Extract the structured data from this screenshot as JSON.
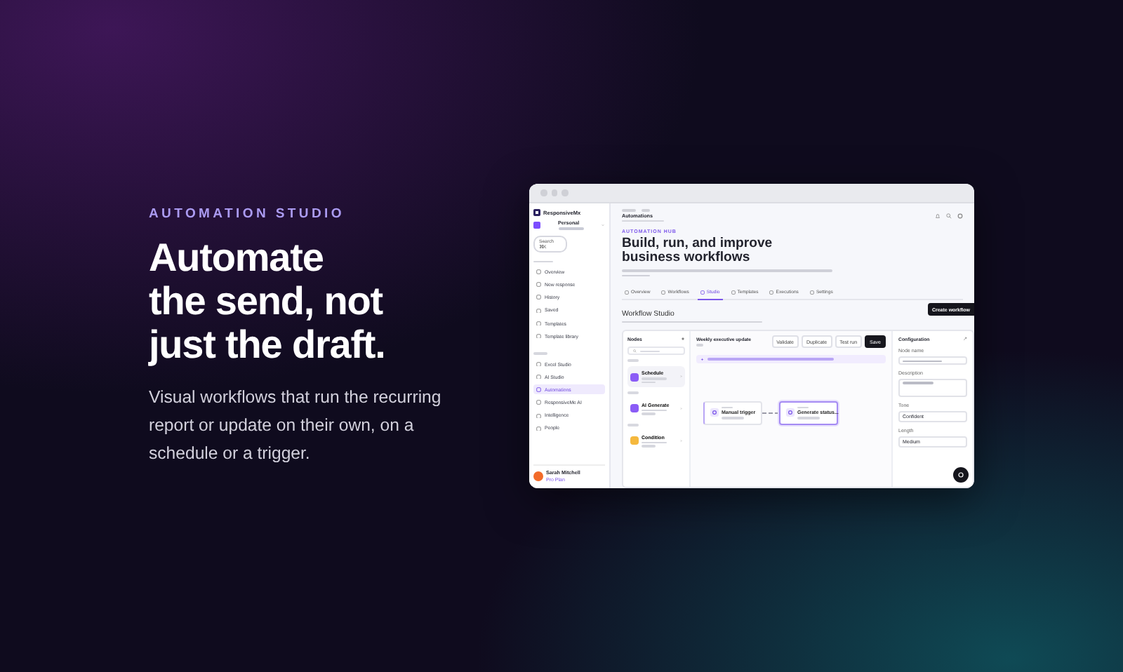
{
  "hero": {
    "eyebrow": "AUTOMATION STUDIO",
    "headline_lines": [
      "Automate",
      "the send, not",
      "just the draft."
    ],
    "body": "Visual workflows that run the recurring report or update on their own, on a schedule or a trigger."
  },
  "app": {
    "sidebar": {
      "brand": "ResponsiveMx",
      "workspace": "Personal",
      "search": "Search ⌘K",
      "main_items": [
        {
          "label": "Overview",
          "selected": false
        },
        {
          "label": "New response",
          "selected": false
        },
        {
          "label": "History",
          "selected": false
        },
        {
          "label": "Saved",
          "selected": false
        },
        {
          "label": "Templates",
          "selected": false
        },
        {
          "label": "Template library",
          "selected": false
        }
      ],
      "studio_items": [
        {
          "label": "Excel Studio",
          "selected": false
        },
        {
          "label": "AI Studio",
          "selected": false
        },
        {
          "label": "Automations",
          "selected": true
        },
        {
          "label": "ResponsiveMe AI",
          "selected": false
        },
        {
          "label": "Intelligence",
          "selected": false
        },
        {
          "label": "People",
          "selected": false
        }
      ],
      "user": {
        "name": "Sarah Mitchell",
        "plan": "Pro Plan"
      }
    },
    "header": {
      "title": "Automations"
    },
    "eyebrow": "AUTOMATION HUB",
    "title": "Build, run, and improve business workflows",
    "create_button": "Create workflow",
    "tabs": [
      {
        "label": "Overview",
        "selected": false
      },
      {
        "label": "Workflows",
        "selected": false
      },
      {
        "label": "Studio",
        "selected": true
      },
      {
        "label": "Templates",
        "selected": false
      },
      {
        "label": "Executions",
        "selected": false
      },
      {
        "label": "Settings",
        "selected": false
      }
    ],
    "studio": {
      "title": "Workflow Studio",
      "nodes_panel": {
        "title": "Nodes",
        "nodes": [
          {
            "label": "Schedule",
            "color": "#8b5cf6",
            "selected": true
          },
          {
            "label": "AI Generate",
            "color": "#8b5cf6",
            "selected": false
          },
          {
            "label": "Condition",
            "color": "#f5b83d",
            "selected": false
          }
        ]
      },
      "canvas": {
        "workflow_name": "Weekly executive update",
        "actions": [
          {
            "label": "Validate",
            "kind": "outline"
          },
          {
            "label": "Duplicate",
            "kind": "outline"
          },
          {
            "label": "Test run",
            "kind": "outline"
          },
          {
            "label": "Save",
            "kind": "primary"
          }
        ],
        "nodes": [
          {
            "label": "Manual trigger",
            "selected": false
          },
          {
            "label": "Generate status...",
            "selected": true
          }
        ]
      },
      "config": {
        "title": "Configuration",
        "fields": [
          {
            "label": "Node name"
          },
          {
            "label": "Description"
          },
          {
            "label": "Tone",
            "value": "Confident"
          },
          {
            "label": "Length",
            "value": "Medium"
          }
        ]
      }
    }
  }
}
